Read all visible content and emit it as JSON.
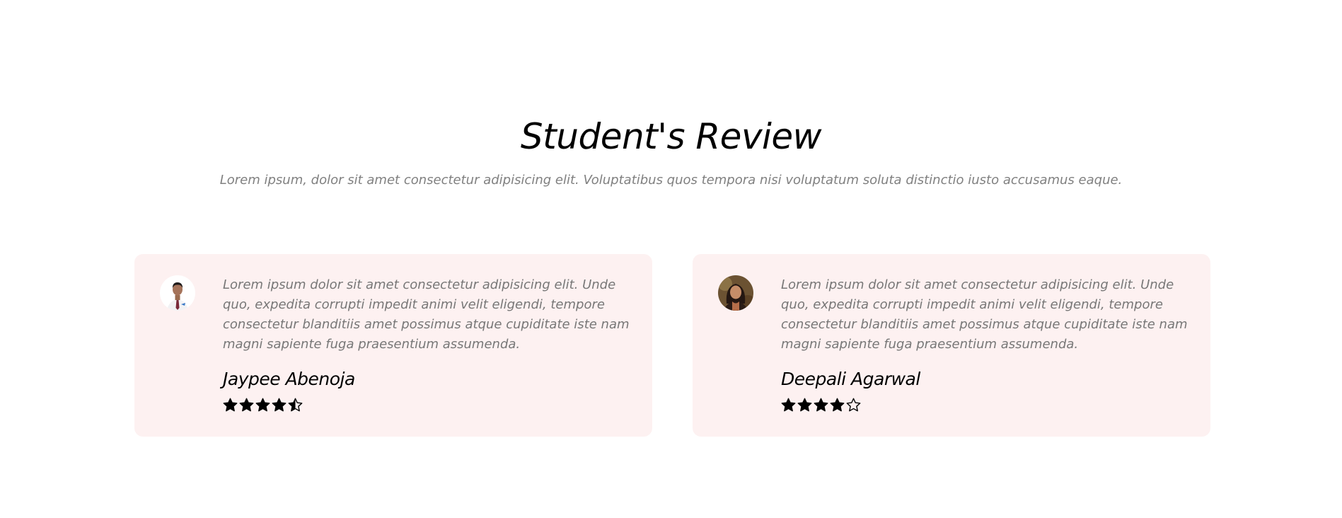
{
  "header": {
    "title": "Student's Review",
    "subtitle": "Lorem ipsum, dolor sit amet consectetur adipisicing elit. Voluptatibus quos tempora nisi voluptatum soluta distinctio iusto accusamus eaque."
  },
  "reviews": [
    {
      "text": "Lorem ipsum dolor sit amet consectetur adipisicing elit. Unde quo, expedita corrupti impedit animi velit eligendi, tempore consectetur blanditiis amet possimus atque cupiditate iste nam magni sapiente fuga praesentium assumenda.",
      "name": "Jaypee Abenoja",
      "rating": 4.5,
      "avatar_icon": "male-student-avatar"
    },
    {
      "text": "Lorem ipsum dolor sit amet consectetur adipisicing elit. Unde quo, expedita corrupti impedit animi velit eligendi, tempore consectetur blanditiis amet possimus atque cupiditate iste nam magni sapiente fuga praesentium assumenda.",
      "name": "Deepali Agarwal",
      "rating": 4,
      "avatar_icon": "female-student-avatar"
    }
  ],
  "colors": {
    "card_background": "#fdf1f1",
    "muted_text": "#777777",
    "star_color": "#000000"
  }
}
